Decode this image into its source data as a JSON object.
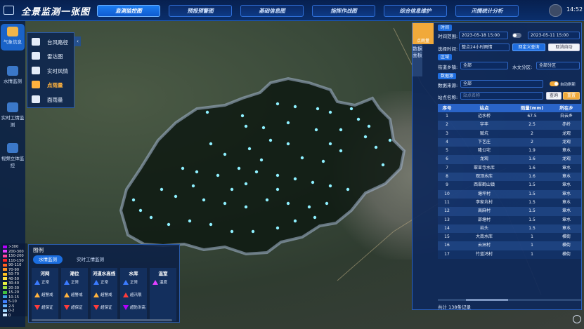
{
  "header": {
    "title": "全景监测一张图",
    "time": "14:52",
    "tabs": [
      {
        "label": "监测监控图",
        "active": true
      },
      {
        "label": "预报预警图",
        "active": false
      },
      {
        "label": "基础信息图",
        "active": false
      },
      {
        "label": "指挥作战图",
        "active": false
      },
      {
        "label": "综合信息维护",
        "active": false
      },
      {
        "label": "汛情统计分析",
        "active": false
      }
    ]
  },
  "leftnav": {
    "items": [
      {
        "label": "气象信息",
        "active": true
      },
      {
        "label": "水情监测",
        "active": false
      },
      {
        "label": "实时工情监测",
        "active": false
      },
      {
        "label": "视频立体监控",
        "active": false
      }
    ]
  },
  "layers": {
    "items": [
      {
        "label": "台风路径",
        "active": false
      },
      {
        "label": "雷达图",
        "active": false
      },
      {
        "label": "实时风情",
        "active": false
      },
      {
        "label": "点雨量",
        "active": true
      },
      {
        "label": "面雨量",
        "active": false
      }
    ]
  },
  "rain_scale": {
    "items": [
      {
        "label": ">300",
        "color": "#b300ff"
      },
      {
        "label": "200-300",
        "color": "#e040ff"
      },
      {
        "label": "150-200",
        "color": "#ff40a0"
      },
      {
        "label": "110-150",
        "color": "#ff2020"
      },
      {
        "label": "90-110",
        "color": "#ff6020"
      },
      {
        "label": "70-90",
        "color": "#ff9020"
      },
      {
        "label": "50-70",
        "color": "#ffc020"
      },
      {
        "label": "40-50",
        "color": "#ffe040"
      },
      {
        "label": "30-40",
        "color": "#e8f040"
      },
      {
        "label": "20-30",
        "color": "#a0e040"
      },
      {
        "label": "15-20",
        "color": "#40c040"
      },
      {
        "label": "10-15",
        "color": "#40a0e0"
      },
      {
        "label": "5-10",
        "color": "#4080ff"
      },
      {
        "label": "2-5",
        "color": "#60b0ff"
      },
      {
        "label": "0-2",
        "color": "#a0d8ff"
      },
      {
        "label": "0",
        "color": "#d0e8ff"
      }
    ]
  },
  "legend": {
    "title": "图例",
    "tabs": [
      {
        "label": "水情监测",
        "active": true
      },
      {
        "label": "实时工情监测",
        "active": false
      }
    ],
    "columns": [
      {
        "header": "河网",
        "rows": [
          {
            "label": "正常",
            "color": "#3b7bff"
          },
          {
            "label": "超警戒",
            "color": "#ffb23e"
          },
          {
            "label": "超保证",
            "color": "#ff3b3b"
          }
        ]
      },
      {
        "header": "潮位",
        "rows": [
          {
            "label": "正常",
            "color": "#3b7bff"
          },
          {
            "label": "超警戒",
            "color": "#ffb23e"
          },
          {
            "label": "超保证",
            "color": "#ff3b3b"
          }
        ]
      },
      {
        "header": "河道水高线",
        "rows": [
          {
            "label": "正常",
            "color": "#3b7bff"
          },
          {
            "label": "超警戒",
            "color": "#ffb23e"
          },
          {
            "label": "超保证",
            "color": "#ff3b3b"
          }
        ]
      },
      {
        "header": "水库",
        "rows": [
          {
            "label": "正常",
            "color": "#3b7bff"
          },
          {
            "label": "超汛限",
            "color": "#ff3b3b"
          },
          {
            "label": "超防洪高",
            "color": "#b300ff"
          }
        ]
      },
      {
        "header": "温室",
        "rows": [
          {
            "label": "温度",
            "color": "#e040ff"
          }
        ]
      }
    ]
  },
  "right_panel": {
    "tab_label": "点雨量",
    "side_tab_label": "数据面板",
    "time_section": "时间",
    "time_range_label": "时间范围:",
    "time_start": "2023-05-18 15:00",
    "time_end": "2023-05-11 15:00",
    "quick_time_label": "选择时间:",
    "quick_time_value": "整点24小时雨情",
    "confirm_button": "回定义查询",
    "cancel_button": "取消自动",
    "region_section": "区域",
    "street_label": "街道乡镇:",
    "street_value": "全部",
    "water_area_label": "水文分区:",
    "water_area_value": "全部分区",
    "data_section": "数据源",
    "data_source_label": "数据来源:",
    "data_source_value": "全部",
    "auto_refresh_label": "自动刷新",
    "station_label": "站点名称:",
    "station_placeholder": "站点名称",
    "query_button": "查询",
    "reset_button": "重置",
    "table": {
      "columns": [
        "序号",
        "站点",
        "雨量(mm)",
        "所在乡"
      ],
      "rows": [
        [
          "1",
          "迈水桥",
          "67.5",
          "白云乡"
        ],
        [
          "2",
          "宇丰",
          "2.5",
          "赤岭"
        ],
        [
          "3",
          "赋坑",
          "2",
          "龙观"
        ],
        [
          "4",
          "下艺庄",
          "2",
          "龙观"
        ],
        [
          "5",
          "隆公宅",
          "1.9",
          "章水"
        ],
        [
          "6",
          "龙观",
          "1.6",
          "龙观"
        ],
        [
          "7",
          "翠亚寺水库",
          "1.6",
          "章水"
        ],
        [
          "8",
          "观顶水库",
          "1.6",
          "章水"
        ],
        [
          "9",
          "西翠鹤山镇",
          "1.5",
          "章水"
        ],
        [
          "10",
          "塘坪村",
          "1.5",
          "章水"
        ],
        [
          "11",
          "李家坑村",
          "1.5",
          "章水"
        ],
        [
          "12",
          "高麻村",
          "1.5",
          "章水"
        ],
        [
          "13",
          "邵塘村",
          "1.5",
          "章水"
        ],
        [
          "14",
          "岩头",
          "1.5",
          "章水"
        ],
        [
          "15",
          "大南水库",
          "1",
          "横街"
        ],
        [
          "16",
          "云洲村",
          "1",
          "横街"
        ],
        [
          "17",
          "竹蓝鸿村",
          "1",
          "横街"
        ]
      ]
    },
    "total_text": "共计 138条记录"
  }
}
